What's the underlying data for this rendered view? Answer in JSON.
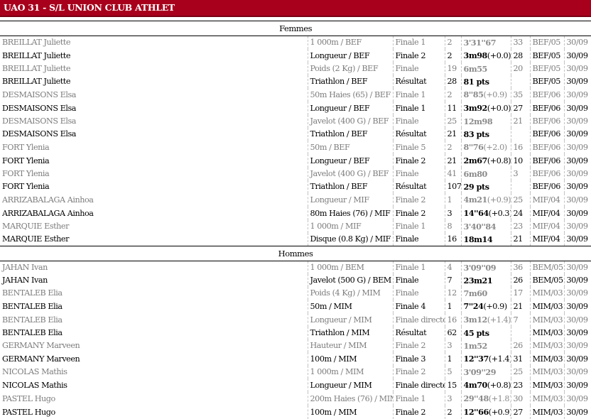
{
  "header": {
    "title": "UAO 31 - S/L UNION CLUB ATHLET"
  },
  "sections": [
    {
      "title": "Femmes",
      "rows": [
        {
          "athlete": "BREILLAT Juliette",
          "event": "1 000m / BEF",
          "round": "Finale 1",
          "place": "2",
          "perf": "3'31''67",
          "wind": "",
          "pts": "33",
          "cat": "BEF/05",
          "date": "30/09",
          "emph": false
        },
        {
          "athlete": "BREILLAT Juliette",
          "event": "Longueur / BEF",
          "round": "Finale 2",
          "place": "2",
          "perf": "3m98",
          "wind": "(+0.0)",
          "pts": "28",
          "cat": "BEF/05",
          "date": "30/09",
          "emph": true
        },
        {
          "athlete": "BREILLAT Juliette",
          "event": "Poids (2 Kg) / BEF",
          "round": "Finale",
          "place": "19",
          "perf": "6m55",
          "wind": "",
          "pts": "20",
          "cat": "BEF/05",
          "date": "30/09",
          "emph": false
        },
        {
          "athlete": "BREILLAT Juliette",
          "event": "Triathlon / BEF",
          "round": "Résultat",
          "place": "28",
          "perf": "81 pts",
          "wind": "",
          "pts": "",
          "cat": "BEF/05",
          "date": "30/09",
          "emph": true
        },
        {
          "athlete": "DESMAISONS Elsa",
          "event": "50m Haies (65) / BEF",
          "round": "Finale 1",
          "place": "2",
          "perf": "8''85",
          "wind": "(+0.9)",
          "pts": "35",
          "cat": "BEF/06",
          "date": "30/09",
          "emph": false
        },
        {
          "athlete": "DESMAISONS Elsa",
          "event": "Longueur / BEF",
          "round": "Finale 1",
          "place": "11",
          "perf": "3m92",
          "wind": "(+0.0)",
          "pts": "27",
          "cat": "BEF/06",
          "date": "30/09",
          "emph": true
        },
        {
          "athlete": "DESMAISONS Elsa",
          "event": "Javelot (400 G) / BEF",
          "round": "Finale",
          "place": "25",
          "perf": "12m98",
          "wind": "",
          "pts": "21",
          "cat": "BEF/06",
          "date": "30/09",
          "emph": false
        },
        {
          "athlete": "DESMAISONS Elsa",
          "event": "Triathlon / BEF",
          "round": "Résultat",
          "place": "21",
          "perf": "83 pts",
          "wind": "",
          "pts": "",
          "cat": "BEF/06",
          "date": "30/09",
          "emph": true
        },
        {
          "athlete": "FORT Ylenia",
          "event": "50m / BEF",
          "round": "Finale 5",
          "place": "2",
          "perf": "8''76",
          "wind": "(+2.0)",
          "pts": "16",
          "cat": "BEF/06",
          "date": "30/09",
          "emph": false
        },
        {
          "athlete": "FORT Ylenia",
          "event": "Longueur / BEF",
          "round": "Finale 2",
          "place": "21",
          "perf": "2m67",
          "wind": "(+0.8)",
          "pts": "10",
          "cat": "BEF/06",
          "date": "30/09",
          "emph": true
        },
        {
          "athlete": "FORT Ylenia",
          "event": "Javelot (400 G) / BEF",
          "round": "Finale",
          "place": "41",
          "perf": "6m80",
          "wind": "",
          "pts": "3",
          "cat": "BEF/06",
          "date": "30/09",
          "emph": false
        },
        {
          "athlete": "FORT Ylenia",
          "event": "Triathlon / BEF",
          "round": "Résultat",
          "place": "107",
          "perf": "29 pts",
          "wind": "",
          "pts": "",
          "cat": "BEF/06",
          "date": "30/09",
          "emph": true
        },
        {
          "athlete": "ARRIZABALAGA Ainhoa",
          "event": "Longueur / MIF",
          "round": "Finale 2",
          "place": "1",
          "perf": "4m21",
          "wind": "(+0.9)",
          "pts": "25",
          "cat": "MIF/04",
          "date": "30/09",
          "emph": false
        },
        {
          "athlete": "ARRIZABALAGA Ainhoa",
          "event": "80m Haies (76) / MIF",
          "round": "Finale 2",
          "place": "3",
          "perf": "14''64",
          "wind": "(+0.3)",
          "pts": "24",
          "cat": "MIF/04",
          "date": "30/09",
          "emph": true
        },
        {
          "athlete": "MARQUIE Esther",
          "event": "1 000m / MIF",
          "round": "Finale 1",
          "place": "8",
          "perf": "3'40''84",
          "wind": "",
          "pts": "23",
          "cat": "MIF/04",
          "date": "30/09",
          "emph": false
        },
        {
          "athlete": "MARQUIE Esther",
          "event": "Disque (0.8 Kg) / MIF",
          "round": "Finale",
          "place": "16",
          "perf": "18m14",
          "wind": "",
          "pts": "21",
          "cat": "MIF/04",
          "date": "30/09",
          "emph": true
        }
      ]
    },
    {
      "title": "Hommes",
      "rows": [
        {
          "athlete": "JAHAN Ivan",
          "event": "1 000m / BEM",
          "round": "Finale 1",
          "place": "4",
          "perf": "3'09''09",
          "wind": "",
          "pts": "36",
          "cat": "BEM/05",
          "date": "30/09",
          "emph": false
        },
        {
          "athlete": "JAHAN Ivan",
          "event": "Javelot (500 G) / BEM",
          "round": "Finale",
          "place": "7",
          "perf": "23m21",
          "wind": "",
          "pts": "26",
          "cat": "BEM/05",
          "date": "30/09",
          "emph": true
        },
        {
          "athlete": "BENTALEB Elia",
          "event": "Poids (4 Kg) / MIM",
          "round": "Finale",
          "place": "12",
          "perf": "7m60",
          "wind": "",
          "pts": "17",
          "cat": "MIM/03",
          "date": "30/09",
          "emph": false
        },
        {
          "athlete": "BENTALEB Elia",
          "event": "50m / MIM",
          "round": "Finale 4",
          "place": "1",
          "perf": "7''24",
          "wind": "(+0.9)",
          "pts": "21",
          "cat": "MIM/03",
          "date": "30/09",
          "emph": true
        },
        {
          "athlete": "BENTALEB Elia",
          "event": "Longueur / MIM",
          "round": "Finale directe",
          "place": "16",
          "perf": "3m12",
          "wind": "(+1.4)",
          "pts": "7",
          "cat": "MIM/03",
          "date": "30/09",
          "emph": false
        },
        {
          "athlete": "BENTALEB Elia",
          "event": "Triathlon / MIM",
          "round": "Résultat",
          "place": "62",
          "perf": "45 pts",
          "wind": "",
          "pts": "",
          "cat": "MIM/03",
          "date": "30/09",
          "emph": true
        },
        {
          "athlete": "GERMANY Marveen",
          "event": "Hauteur / MIM",
          "round": "Finale 2",
          "place": "3",
          "perf": "1m52",
          "wind": "",
          "pts": "26",
          "cat": "MIM/03",
          "date": "30/09",
          "emph": false
        },
        {
          "athlete": "GERMANY Marveen",
          "event": "100m / MIM",
          "round": "Finale 3",
          "place": "1",
          "perf": "12''37",
          "wind": "(+1.4)",
          "pts": "31",
          "cat": "MIM/03",
          "date": "30/09",
          "emph": true
        },
        {
          "athlete": "NICOLAS Mathis",
          "event": "1 000m / MIM",
          "round": "Finale 2",
          "place": "5",
          "perf": "3'09''29",
          "wind": "",
          "pts": "25",
          "cat": "MIM/03",
          "date": "30/09",
          "emph": false
        },
        {
          "athlete": "NICOLAS Mathis",
          "event": "Longueur / MIM",
          "round": "Finale directe",
          "place": "15",
          "perf": "4m70",
          "wind": "(+0.8)",
          "pts": "23",
          "cat": "MIM/03",
          "date": "30/09",
          "emph": true
        },
        {
          "athlete": "PASTEL Hugo",
          "event": "200m Haies (76) / MIM",
          "round": "Finale 1",
          "place": "3",
          "perf": "29''48",
          "wind": "(+1.8)",
          "pts": "30",
          "cat": "MIM/03",
          "date": "30/09",
          "emph": false
        },
        {
          "athlete": "PASTEL Hugo",
          "event": "100m / MIM",
          "round": "Finale 2",
          "place": "2",
          "perf": "12''66",
          "wind": "(+0.9)",
          "pts": "27",
          "cat": "MIM/03",
          "date": "30/09",
          "emph": true
        }
      ]
    }
  ]
}
